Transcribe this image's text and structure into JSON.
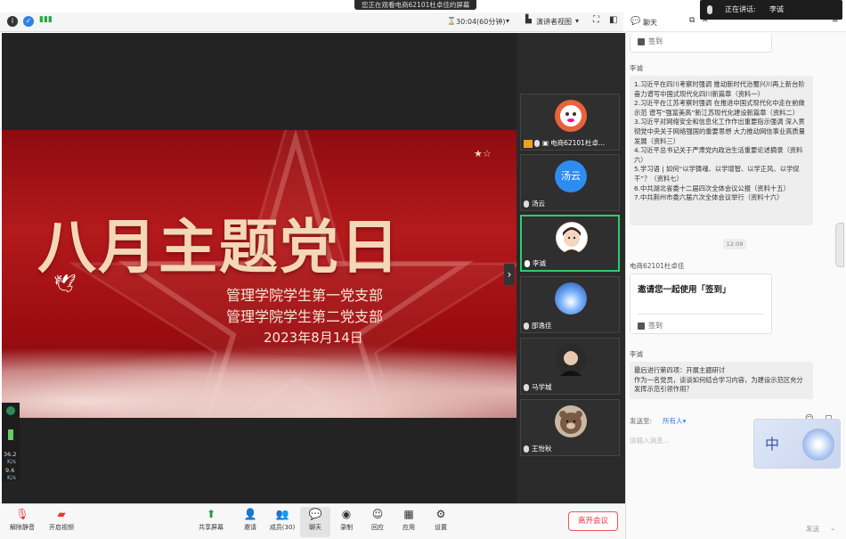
{
  "banner": {
    "text": "您正在观看电商62101杜卓佳的屏幕"
  },
  "topbar": {
    "timer": "30:04(60分钟)",
    "view_mode": "演讲者视图"
  },
  "slide": {
    "title": "八月主题党日",
    "line1": "管理学院学生第一党支部",
    "line2": "管理学院学生第二党支部",
    "date": "2023年8月14日"
  },
  "participants": [
    {
      "name": "电商62101杜卓...",
      "avatar_label": "",
      "avatar_color": "#e9633a"
    },
    {
      "name": "汤云",
      "avatar_label": "汤云",
      "avatar_color": "#2d8cf0"
    },
    {
      "name": "李诚",
      "avatar_label": "",
      "avatar_color": "#f0d6c4"
    },
    {
      "name": "邵逸佳",
      "avatar_label": "",
      "avatar_color": "#2b5fb0"
    },
    {
      "name": "马学城",
      "avatar_label": "",
      "avatar_color": "#2b2b2b"
    },
    {
      "name": "王怡秋",
      "avatar_label": "",
      "avatar_color": "#8b6a52"
    }
  ],
  "netstat": {
    "line1": "36.2",
    "line2": "K/s",
    "line3": "9.6",
    "line4": "K/s"
  },
  "toolbar": {
    "unmute": "解除静音",
    "video": "开启视频",
    "share": "共享屏幕",
    "invite": "邀请",
    "members": "成员(30)",
    "chat": "聊天",
    "record": "录制",
    "reply": "回应",
    "apps": "应用",
    "settings": "设置",
    "leave": "离开会议"
  },
  "speaker": {
    "label": "正在讲话:",
    "name": "李诚"
  },
  "chat": {
    "tab": "聊天",
    "signin_label": "签到",
    "msg1_sender": "李诚",
    "msg1_lines": [
      "1.习近平在四川考察时强调 推动新时代治蜀兴川再上新台阶 奋力谱写中国式现代化四川新篇章（资料一）",
      "2.习近平在江苏考察时强调 在推进中国式现代化中走在前做示范 谱写“强富美高”新江苏现代化建设新篇章（资料二）",
      "3.习近平对网络安全和信息化工作作出重要指示强调 深入贯彻党中央关于网络强国的重要思想 大力推动网信事业高质量发展（资料三）",
      "4.习近平总书记关于严肃党内政治生活重要论述摘录（资料六）",
      "5.学习语 | 如何“以学铸魂、以学增智、以学正风、以学促干”？（资料七）",
      "6.中共湖北省委十二届四次全体会议公报（资料十五）",
      "7.中共荆州市委六届六次全体会议举行（资料十六）"
    ],
    "time": "12:09",
    "msg2_sender": "电商62101杜卓佳",
    "card_title": "邀请您一起使用「签到」",
    "msg3_sender": "李诚",
    "msg3_text": "最后进行第四项：开展主题研讨\n作为一名党员，谈谈如何结合学习内容，为建设示范区充分发挥示范引领作用？",
    "send_to_label": "发送至:",
    "send_to_value": "所有人▾",
    "input_placeholder": "请输入消息...",
    "send_label": "发送"
  }
}
